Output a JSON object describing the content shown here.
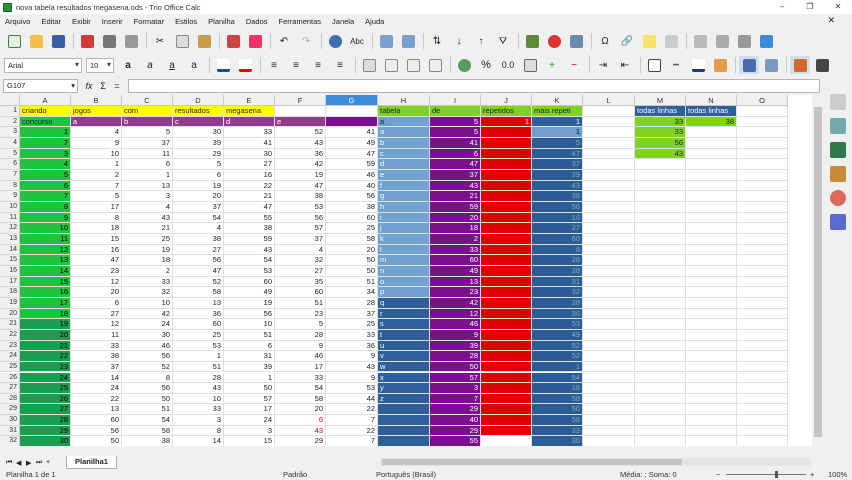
{
  "window": {
    "title": "nova tabela resultados megasena.ods - Trio Office Calc",
    "min": "–",
    "max": "❐",
    "close": "✕"
  },
  "menu": [
    "Arquivo",
    "Editar",
    "Exibir",
    "Inserir",
    "Formatar",
    "Estilos",
    "Planilha",
    "Dados",
    "Ferramentas",
    "Janela",
    "Ajuda"
  ],
  "formatting": {
    "font_name": "Arial",
    "font_size": "10",
    "bold": "a",
    "italic": "a",
    "underline": "a",
    "shadow": "a",
    "percent": "%",
    "decimal": "0.0",
    "sigma": "Σ"
  },
  "formula_bar": {
    "name_box": "G107",
    "fx": "fx",
    "sum": "Σ",
    "equals": "="
  },
  "columns": [
    {
      "name": "A",
      "w": 51
    },
    {
      "name": "B",
      "w": 51
    },
    {
      "name": "C",
      "w": 51
    },
    {
      "name": "D",
      "w": 51
    },
    {
      "name": "E",
      "w": 51
    },
    {
      "name": "F",
      "w": 51
    },
    {
      "name": "G",
      "w": 52,
      "selected": true
    },
    {
      "name": "H",
      "w": 52
    },
    {
      "name": "I",
      "w": 51
    },
    {
      "name": "J",
      "w": 51
    },
    {
      "name": "K",
      "w": 51
    },
    {
      "name": "L",
      "w": 52
    },
    {
      "name": "M",
      "w": 51
    },
    {
      "name": "N",
      "w": 51
    },
    {
      "name": "O",
      "w": 51
    }
  ],
  "row_numbers": [
    1,
    2,
    3,
    4,
    5,
    6,
    7,
    8,
    9,
    10,
    11,
    12,
    13,
    14,
    15,
    16,
    17,
    18,
    19,
    20,
    21,
    22,
    23,
    24,
    25,
    26,
    27,
    28,
    29,
    30,
    31,
    32
  ],
  "header_row": [
    "criando",
    "jogos",
    "com",
    "resultados",
    "megasena",
    "",
    "",
    "tabela",
    "de",
    "repetidos",
    "mais repeti",
    "",
    "todas linhas",
    "todas linhas",
    ""
  ],
  "row2": [
    "concurso",
    "a",
    "b",
    "c",
    "d",
    "e",
    "",
    "a",
    "5",
    "1",
    "1",
    "",
    "33",
    "38",
    ""
  ],
  "data": {
    "A": [
      1,
      7,
      3,
      4,
      5,
      6,
      7,
      8,
      9,
      10,
      11,
      12,
      13,
      14,
      15,
      16,
      17,
      18,
      19,
      20,
      21,
      22,
      23,
      24,
      25,
      26,
      27,
      28,
      29,
      30
    ],
    "B": [
      4,
      9,
      10,
      1,
      2,
      7,
      5,
      17,
      8,
      18,
      15,
      16,
      47,
      23,
      12,
      20,
      6,
      27,
      12,
      11,
      33,
      38,
      37,
      14,
      24,
      22,
      13,
      60,
      56,
      50
    ],
    "C": [
      5,
      37,
      11,
      6,
      1,
      13,
      3,
      4,
      43,
      21,
      25,
      19,
      18,
      2,
      33,
      32,
      10,
      42,
      24,
      30,
      46,
      56,
      52,
      8,
      56,
      50,
      51,
      54,
      58,
      38
    ],
    "D": [
      30,
      39,
      29,
      5,
      6,
      19,
      20,
      37,
      54,
      4,
      38,
      27,
      56,
      47,
      52,
      58,
      13,
      36,
      60,
      25,
      53,
      1,
      51,
      28,
      43,
      10,
      33,
      3,
      8,
      14
    ],
    "E": [
      33,
      41,
      30,
      27,
      16,
      22,
      21,
      47,
      55,
      38,
      59,
      43,
      54,
      53,
      60,
      49,
      19,
      56,
      10,
      51,
      6,
      31,
      39,
      1,
      50,
      57,
      17,
      24,
      3,
      15
    ],
    "F": [
      52,
      43,
      36,
      42,
      19,
      47,
      38,
      53,
      56,
      57,
      37,
      4,
      32,
      27,
      35,
      60,
      51,
      23,
      5,
      28,
      9,
      46,
      17,
      33,
      54,
      58,
      20,
      6,
      43,
      29
    ],
    "G": [
      41,
      49,
      47,
      59,
      46,
      40,
      56,
      38,
      60,
      25,
      58,
      20,
      50,
      50,
      51,
      34,
      28,
      37,
      25,
      33,
      36,
      9,
      43,
      9,
      53,
      44,
      22,
      7,
      22,
      7
    ],
    "H": [
      "a",
      "b",
      "c",
      "d",
      "e",
      "f",
      "g",
      "h",
      "i",
      "j",
      "k",
      "l",
      "m",
      "n",
      "o",
      "p",
      "q",
      "r",
      "s",
      "t",
      "u",
      "v",
      "w",
      "x",
      "y",
      "z",
      "",
      "",
      "",
      ""
    ],
    "I": [
      5,
      41,
      6,
      47,
      37,
      43,
      21,
      59,
      20,
      18,
      2,
      33,
      60,
      49,
      13,
      23,
      42,
      12,
      46,
      9,
      39,
      28,
      50,
      57,
      3,
      7,
      29,
      40,
      29,
      55
    ],
    "J": [
      1,
      1,
      1,
      1,
      1,
      1,
      1,
      1,
      1,
      1,
      1,
      1,
      1,
      1,
      1,
      1,
      1,
      1,
      1,
      1,
      1,
      1,
      1,
      1,
      1,
      1,
      1,
      1,
      1,
      ""
    ],
    "K": [
      1,
      5,
      47,
      37,
      39,
      43,
      38,
      56,
      16,
      27,
      60,
      8,
      26,
      38,
      31,
      32,
      38,
      36,
      53,
      49,
      52,
      52,
      1,
      54,
      18,
      58,
      50,
      58,
      33,
      30
    ],
    "M": [
      33,
      56,
      43
    ],
    "N": [
      38
    ]
  },
  "colors": {
    "yellow": "#ffff00",
    "green": "#1ec43a",
    "green_dark": "#1a9e52",
    "purple": "#8e3d8a",
    "purple_dark": "#7a0e8c",
    "red": "#e00000",
    "blue_light": "#6fa0d0",
    "blue_dark": "#2e5f9a",
    "blue_k": "#2c5c96",
    "lime": "#7ed321",
    "green_label": "#7ed321",
    "selection": "#3c8cdc"
  },
  "sheet_tab": "Planilha1",
  "status": {
    "sheet": "Planilha 1 de 1",
    "style": "Padrão",
    "language": "Português (Brasil)",
    "summary": "Média: ; Soma: 0",
    "zoom": "100%"
  }
}
